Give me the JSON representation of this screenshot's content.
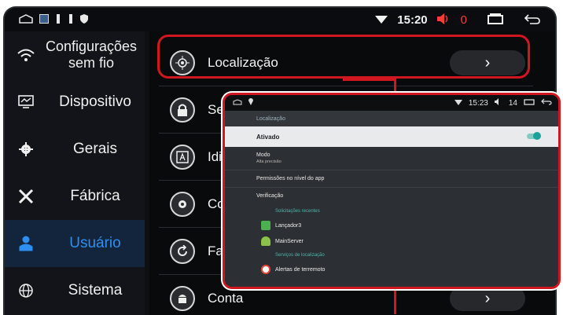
{
  "status_bar": {
    "time": "15:20",
    "volume_count": "0"
  },
  "sidebar": {
    "items": [
      {
        "label": "Configurações sem fio",
        "icon": "wifi-icon"
      },
      {
        "label": "Dispositivo",
        "icon": "monitor-icon"
      },
      {
        "label": "Gerais",
        "icon": "gear-icon"
      },
      {
        "label": "Fábrica",
        "icon": "tools-icon"
      },
      {
        "label": "Usuário",
        "icon": "user-icon"
      },
      {
        "label": "Sistema",
        "icon": "globe-icon"
      }
    ],
    "active_index": 4
  },
  "main": {
    "rows": [
      {
        "label": "Localização",
        "icon": "location-icon"
      },
      {
        "label": "Seg",
        "icon": "lock-icon"
      },
      {
        "label": "Idi",
        "icon": "language-icon"
      },
      {
        "label": "Con",
        "icon": "settings-icon"
      },
      {
        "label": "Faz",
        "icon": "backup-icon"
      },
      {
        "label": "Conta",
        "icon": "android-icon"
      }
    ],
    "arrow": "›"
  },
  "popup": {
    "time": "15:23",
    "volume_count": "14",
    "header": "Localização",
    "ativado": "Ativado",
    "mode_title": "Modo",
    "mode_value": "Alta precisão",
    "app_permissions": "Permissões no nível do app",
    "verification": "Verificação",
    "recent_requests": "Solicitações recentes",
    "apps": [
      "Lançador3",
      "MainServer"
    ],
    "services_header": "Serviços de localização",
    "earthquake": "Alertas de terremoto"
  },
  "colors": {
    "accent": "#2e8ff0",
    "highlight": "#d0161e",
    "toggle": "#1aa39a"
  }
}
